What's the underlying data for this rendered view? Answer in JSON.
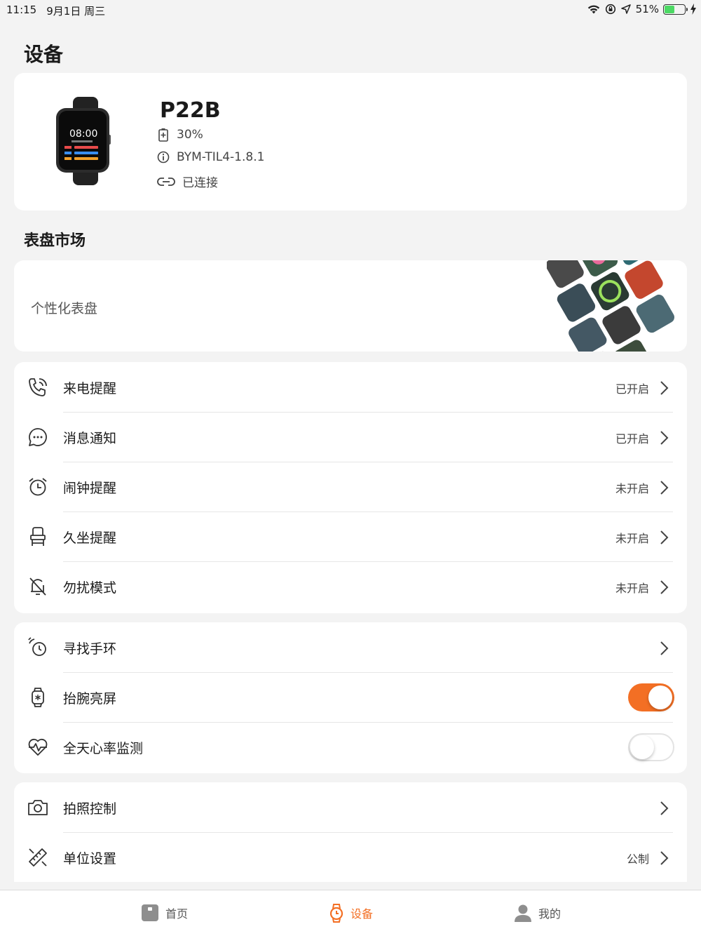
{
  "status_bar": {
    "time": "11:15",
    "date": "9月1日 周三",
    "battery": "51%",
    "battery_level": 0.51
  },
  "page_title": "设备",
  "device": {
    "name": "P22B",
    "battery": "30%",
    "firmware": "BYM-TIL4-1.8.1",
    "connection": "已连接",
    "watch_time": "08:00"
  },
  "dial_market": {
    "title": "表盘市场",
    "label": "个性化表盘"
  },
  "notifications": [
    {
      "icon": "phone-call-icon",
      "label": "来电提醒",
      "value": "已开启"
    },
    {
      "icon": "message-icon",
      "label": "消息通知",
      "value": "已开启"
    },
    {
      "icon": "alarm-clock-icon",
      "label": "闹钟提醒",
      "value": "未开启"
    },
    {
      "icon": "chair-icon",
      "label": "久坐提醒",
      "value": "未开启"
    },
    {
      "icon": "bell-off-icon",
      "label": "勿扰模式",
      "value": "未开启"
    }
  ],
  "controls": [
    {
      "icon": "vibrate-icon",
      "label": "寻找手环"
    },
    {
      "icon": "watch-icon",
      "label": "抬腕亮屏",
      "toggle": true
    },
    {
      "icon": "heart-rate-icon",
      "label": "全天心率监测",
      "toggle": false
    }
  ],
  "settings": [
    {
      "icon": "camera-icon",
      "label": "拍照控制",
      "value": ""
    },
    {
      "icon": "ruler-icon",
      "label": "单位设置",
      "value": "公制"
    }
  ],
  "tabs": [
    {
      "icon": "home-icon",
      "label": "首页"
    },
    {
      "icon": "device-watch-icon",
      "label": "设备",
      "active": true
    },
    {
      "icon": "user-icon",
      "label": "我的"
    }
  ],
  "colors": {
    "accent": "#f36f24",
    "background": "#f3f3f3",
    "battery_green": "#4cd964"
  }
}
